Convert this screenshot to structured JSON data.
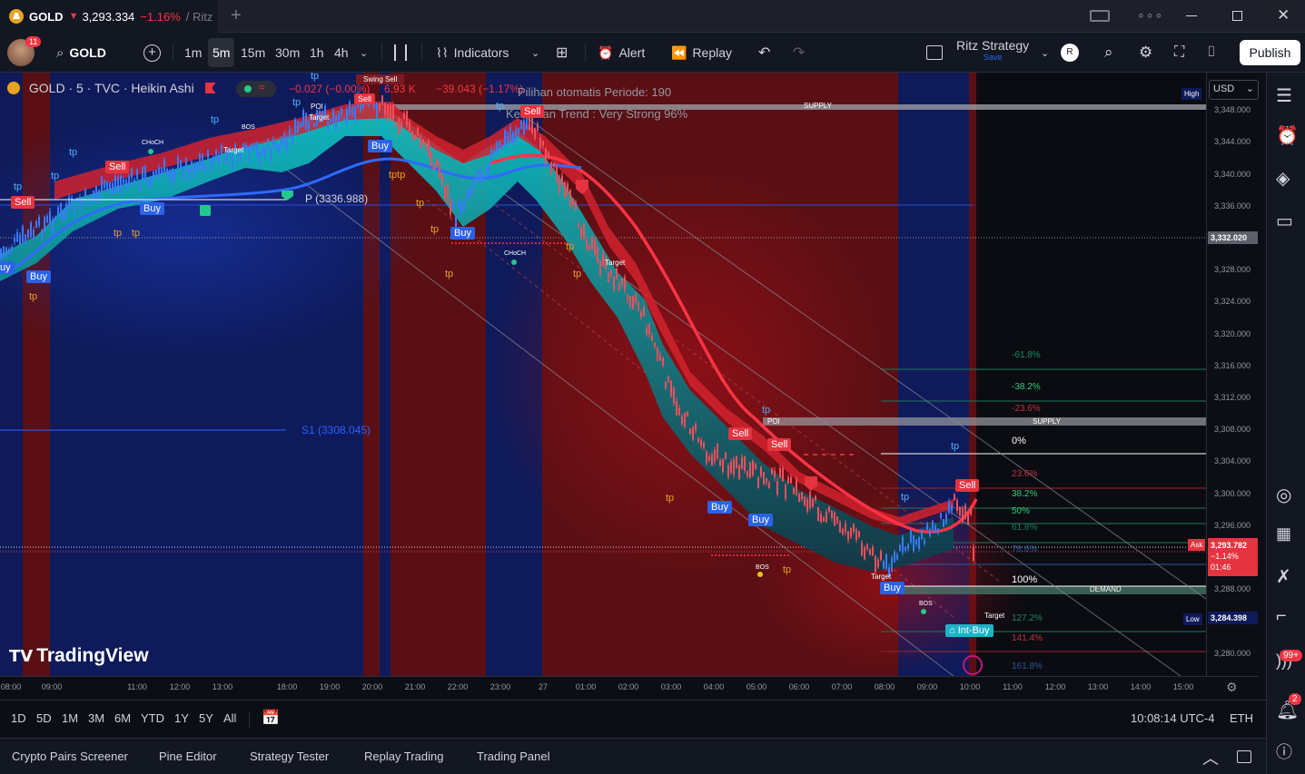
{
  "tab": {
    "symbol": "GOLD",
    "price": "3,293.334",
    "change": "−1.16%",
    "suffix": "/ Ritz"
  },
  "toolbar": {
    "symbol": "GOLD",
    "avatar_badge": "11",
    "intervals": [
      "1m",
      "5m",
      "15m",
      "30m",
      "1h",
      "4h"
    ],
    "active_interval": "5m",
    "indicators": "Indicators",
    "alert": "Alert",
    "replay": "Replay",
    "strategy": "Ritz Strategy",
    "strategy_sub": "Save",
    "publish": "Publish",
    "user_initial": "R"
  },
  "legend": {
    "title": "GOLD · 5 · TVC · Heikin Ashi",
    "values": "−0.027 (−0.00%)",
    "volume": "6.93 K",
    "change": "−39.043 (−1.17%)",
    "swing": "Swing Sell",
    "info1": "Pilihan otomatis Periode: 190",
    "info2": "Kekuatan Trend : Very Strong 96%"
  },
  "price_axis": {
    "currency": "USD",
    "high_label": "High",
    "low_label": "Low",
    "ask_label": "Ask",
    "current_price": "3,293.782",
    "pct": "−1.14%",
    "countdown": "01:46",
    "marker_price": "3,332.020",
    "low_price": "3,284.398",
    "ticks": [
      "3,348.000",
      "3,344.000",
      "3,340.000",
      "3,336.000",
      "3,328.000",
      "3,324.000",
      "3,320.000",
      "3,316.000",
      "3,312.000",
      "3,308.000",
      "3,304.000",
      "3,300.000",
      "3,296.000",
      "3,288.000",
      "3,280.000"
    ]
  },
  "time_axis": {
    "labels": [
      "08:00",
      "09:00",
      "11:00",
      "12:00",
      "13:00",
      "18:00",
      "19:00",
      "20:00",
      "21:00",
      "22:00",
      "23:00",
      "27",
      "01:00",
      "02:00",
      "03:00",
      "04:00",
      "05:00",
      "06:00",
      "07:00",
      "08:00",
      "09:00",
      "10:00",
      "11:00",
      "12:00",
      "13:00",
      "14:00",
      "15:00"
    ]
  },
  "chart_labels": {
    "supply1": "SUPPLY",
    "supply2": "SUPPLY",
    "demand": "DEMAND",
    "pivot": "P (3336.988)",
    "s1": "S1 (3308.045)",
    "watermark": "TradingView",
    "poi": "POI",
    "choch": "CHoCH",
    "bos": "BOS",
    "target": "Target",
    "tp": "tp",
    "tptp": "tptp",
    "sell": "Sell",
    "buy": "Buy",
    "int_buy": "Int-Buy"
  },
  "fib": [
    "-61.8%",
    "-38.2%",
    "-23.6%",
    "0%",
    "23.6%",
    "38.2%",
    "50%",
    "61.8%",
    "78.6%",
    "100%",
    "127.2%",
    "141.4%",
    "161.8%"
  ],
  "range_bar": {
    "ranges": [
      "1D",
      "5D",
      "1M",
      "3M",
      "6M",
      "YTD",
      "1Y",
      "5Y",
      "All"
    ],
    "clock": "10:08:14 UTC-4",
    "session": "ETH"
  },
  "bottom_tabs": [
    "Crypto Pairs Screener",
    "Pine Editor",
    "Strategy Tester",
    "Replay Trading",
    "Trading Panel"
  ],
  "sidebar": {
    "notif_badge": "99+",
    "alert_badge": "2"
  }
}
